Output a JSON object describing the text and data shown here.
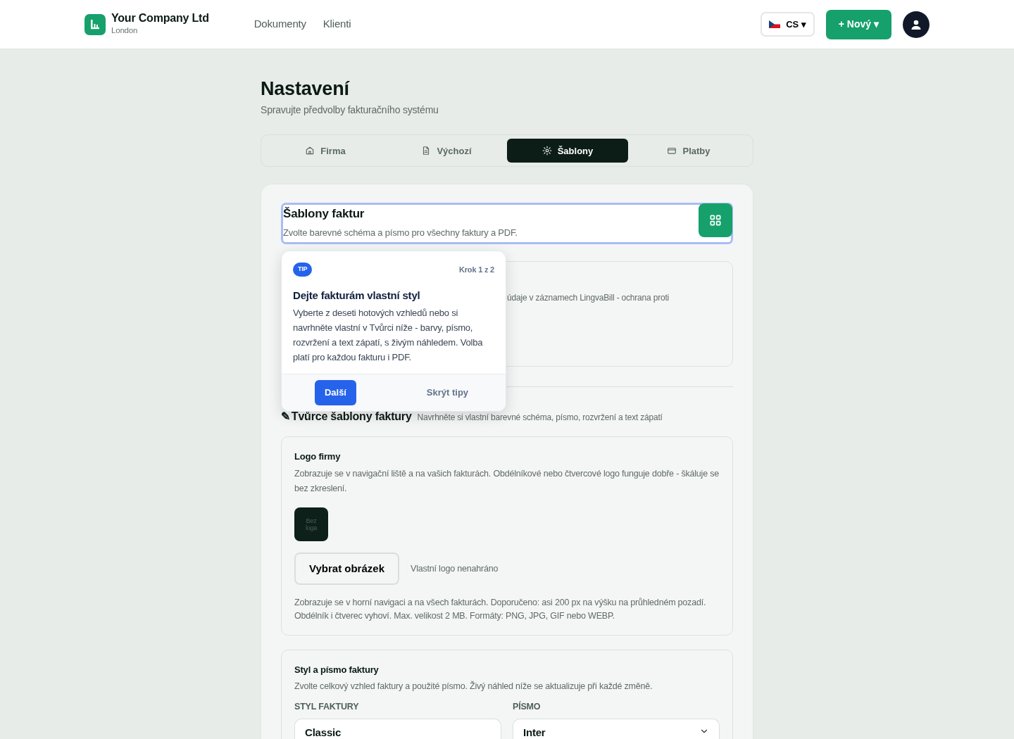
{
  "navbar": {
    "brand": {
      "name": "Your Company Ltd",
      "location": "London"
    },
    "links": [
      {
        "label": "Dokumenty"
      },
      {
        "label": "Klienti"
      }
    ],
    "language": {
      "code": "CS",
      "caret": "▾"
    },
    "new_button": {
      "plus": "+",
      "label": "Nový",
      "caret": "▾"
    }
  },
  "page": {
    "title": "Nastavení",
    "subtitle": "Spravujte předvolby fakturačního systému"
  },
  "tabs": [
    {
      "label": "Firma",
      "selected": false
    },
    {
      "label": "Výchozí",
      "selected": false
    },
    {
      "label": "Šablony",
      "selected": true
    },
    {
      "label": "Platby",
      "selected": false
    }
  ],
  "section": {
    "title": "Šablony faktur",
    "description": "Zvolte barevné schéma a písmo pro všechny faktury a PDF."
  },
  "covered_card": {
    "text": "údaje v záznamech LingvaBill - ochrana proti"
  },
  "tooltip": {
    "badge": "TIP",
    "step": "Krok 1 z 2",
    "title": "Dejte fakturám vlastní styl",
    "body": "Vyberte z deseti hotových vzhledů nebo si navrhněte vlastní v Tvůrci níže - barvy, písmo, rozvržení a text zápatí, s živým náhledem. Volba platí pro každou fakturu i PDF.",
    "next": "Další",
    "dismiss": "Skrýt tipy"
  },
  "builder": {
    "icon": "✎",
    "title": "Tvůrce šablony faktury",
    "description": "Navrhněte si vlastní barevné schéma, písmo, rozvržení a text zápatí"
  },
  "logo_card": {
    "title": "Logo firmy",
    "description": "Zobrazuje se v navigační liště a na vašich fakturách. Obdélníkové nebo čtvercové logo funguje dobře - škáluje se bez zkreslení.",
    "placeholder": "Bez loga",
    "button": "Vybrat obrázek",
    "status": "Vlastní logo nenahráno",
    "help": "Zobrazuje se v horní navigaci a na všech fakturách. Doporučeno: asi 200 px na výšku na průhledném pozadí. Obdélník i čtverec vyhoví. Max. velikost 2 MB. Formáty: PNG, JPG, GIF nebo WEBP."
  },
  "style_card": {
    "title": "Styl a písmo faktury",
    "description": "Zvolte celkový vzhled faktury a použité písmo. Živý náhled níže se aktualizuje při každé změně.",
    "fields": [
      {
        "label": "STYL FAKTURY",
        "value": "Classic",
        "kind": "card"
      },
      {
        "label": "PÍSMO",
        "value": "Inter",
        "kind": "select"
      }
    ]
  }
}
